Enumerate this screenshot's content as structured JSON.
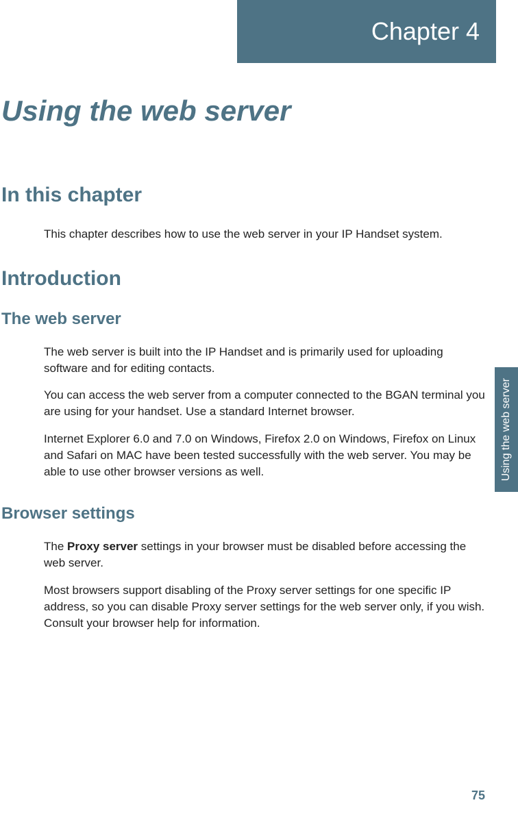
{
  "chapter": {
    "label": "Chapter 4"
  },
  "side_tab": "Using the web server",
  "title": "Using the web server",
  "sections": {
    "in_this_chapter": {
      "heading": "In this chapter",
      "p1": "This chapter describes how to use the web server in your IP Handset system."
    },
    "introduction": {
      "heading": "Introduction"
    },
    "web_server": {
      "heading": "The web server",
      "p1": "The web server is built into the IP Handset and is primarily used for uploading software and for editing contacts.",
      "p2": "You can access the web server from a computer connected to the BGAN terminal you are using for your handset. Use a standard Internet browser.",
      "p3": "Internet Explorer 6.0 and 7.0 on Windows, Firefox 2.0 on Windows, Firefox on Linux and Safari on MAC have been tested successfully with the web server. You may be able to use other browser versions as well."
    },
    "browser_settings": {
      "heading": "Browser settings",
      "p1_prefix": "The ",
      "p1_bold": "Proxy server",
      "p1_suffix": " settings in your browser must be disabled before accessing the web server.",
      "p2": "Most browsers support disabling of the Proxy server settings for one specific IP address, so you can disable Proxy server settings for the web server only, if you wish. Consult your browser help for information."
    }
  },
  "page_number": "75"
}
